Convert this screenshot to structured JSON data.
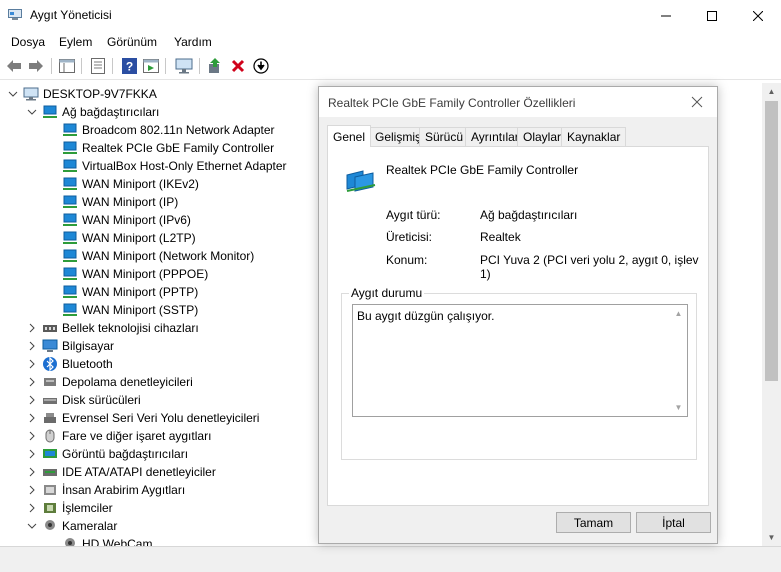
{
  "window": {
    "title": "Aygıt Yöneticisi"
  },
  "menu": [
    "Dosya",
    "Eylem",
    "Görünüm",
    "Yardım"
  ],
  "toolbar": {
    "icons": [
      "back-icon",
      "forward-icon",
      "show-hide-tree-icon",
      "properties-icon",
      "help-icon",
      "run-action-icon",
      "monitor-scan-icon",
      "update-driver-icon",
      "uninstall-x-icon",
      "install-arrow-icon"
    ]
  },
  "tree": {
    "root": "DESKTOP-9V7FKKA",
    "network_category": "Ağ bağdaştırıcıları",
    "network_devices": [
      "Broadcom 802.11n Network Adapter",
      "Realtek PCIe GbE Family Controller",
      "VirtualBox Host-Only Ethernet Adapter",
      "WAN Miniport (IKEv2)",
      "WAN Miniport (IP)",
      "WAN Miniport (IPv6)",
      "WAN Miniport (L2TP)",
      "WAN Miniport (Network Monitor)",
      "WAN Miniport (PPPOE)",
      "WAN Miniport (PPTP)",
      "WAN Miniport (SSTP)"
    ],
    "categories": [
      "Bellek teknolojisi cihazları",
      "Bilgisayar",
      "Bluetooth",
      "Depolama denetleyicileri",
      "Disk sürücüleri",
      "Evrensel Seri Veri Yolu denetleyicileri",
      "Fare ve diğer işaret aygıtları",
      "Görüntü bağdaştırıcıları",
      "IDE ATA/ATAPI denetleyiciler",
      "İnsan Arabirim Aygıtları",
      "İşlemciler",
      "Kameralar"
    ],
    "camera_child": "HD WebCam"
  },
  "dialog": {
    "title": "Realtek PCIe GbE Family Controller Özellikleri",
    "tabs": [
      "Genel",
      "Gelişmiş",
      "Sürücü",
      "Ayrıntılar",
      "Olaylar",
      "Kaynaklar"
    ],
    "device_name": "Realtek PCIe GbE Family Controller",
    "props": {
      "type_label": "Aygıt türü:",
      "type_value": "Ağ bağdaştırıcıları",
      "maker_label": "Üreticisi:",
      "maker_value": "Realtek",
      "location_label": "Konum:",
      "location_value": "PCI Yuva 2 (PCI veri yolu 2, aygıt 0, işlev 1)"
    },
    "status_group": "Aygıt durumu",
    "status_text": "Bu aygıt düzgün çalışıyor.",
    "ok_label": "Tamam",
    "cancel_label": "İptal"
  },
  "colors": {
    "net_icon": "#1e88d6",
    "uninstall": "#d0021b",
    "update": "#2e9c3a"
  }
}
